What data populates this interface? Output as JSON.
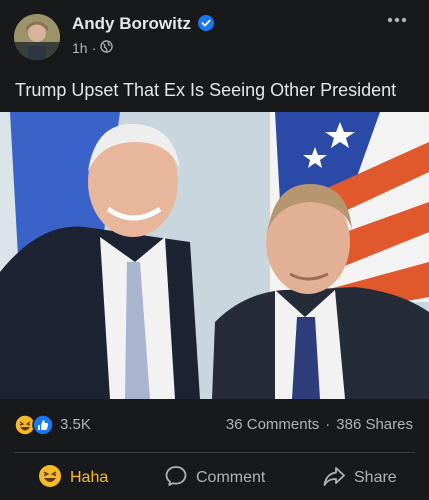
{
  "post": {
    "author": "Andy Borowitz",
    "time": "1h",
    "separator": "·",
    "text": "Trump Upset That Ex Is Seeing Other President"
  },
  "stats": {
    "reactions": "3.5K",
    "comments": "36 Comments",
    "dot": "·",
    "shares": "386 Shares"
  },
  "actions": {
    "haha": "Haha",
    "comment": "Comment",
    "share": "Share"
  },
  "colors": {
    "background": "#18191a",
    "text": "#e4e6eb",
    "muted": "#b0b3b8",
    "verified": "#1877f2",
    "haha": "#f7b928"
  }
}
